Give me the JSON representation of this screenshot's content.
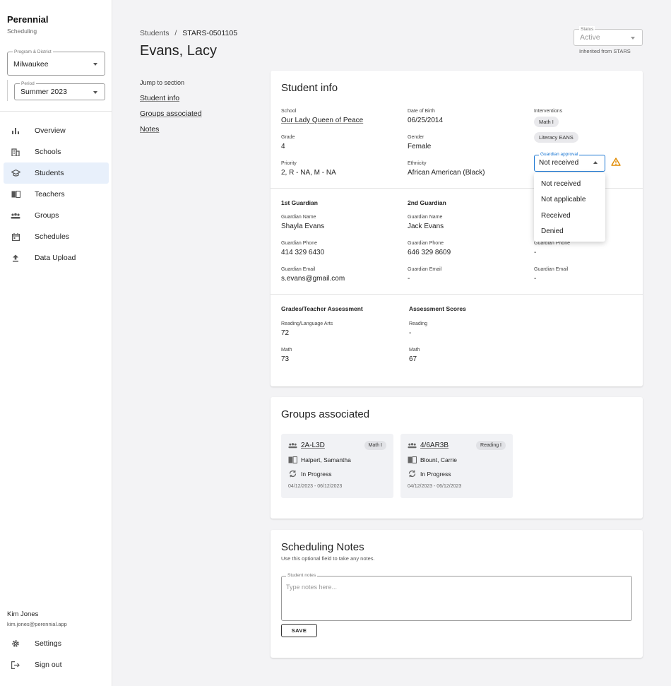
{
  "brand": {
    "title": "Perennial",
    "subtitle": "Scheduling"
  },
  "program_select": {
    "label": "Program & District",
    "value": "Milwaukee"
  },
  "period_select": {
    "label": "Period",
    "value": "Summer 2023"
  },
  "nav": [
    {
      "label": "Overview",
      "icon": "bar-chart-icon"
    },
    {
      "label": "Schools",
      "icon": "building-icon"
    },
    {
      "label": "Students",
      "icon": "graduation-cap-icon",
      "active": true
    },
    {
      "label": "Teachers",
      "icon": "book-icon"
    },
    {
      "label": "Groups",
      "icon": "people-group-icon"
    },
    {
      "label": "Schedules",
      "icon": "calendar-icon"
    },
    {
      "label": "Data Upload",
      "icon": "upload-icon"
    }
  ],
  "user": {
    "name": "Kim Jones",
    "email": "kim.jones@perennial.app"
  },
  "bottom_nav": {
    "settings": "Settings",
    "signout": "Sign out"
  },
  "breadcrumb": {
    "root": "Students",
    "sep": "/",
    "current": "STARS-0501105"
  },
  "page_title": "Evans, Lacy",
  "status": {
    "label": "Status",
    "value": "Active",
    "note": "Inherited from STARS"
  },
  "jump": {
    "title": "Jump to section",
    "links": [
      "Student info",
      "Groups associated",
      "Notes"
    ]
  },
  "student_info": {
    "title": "Student info",
    "school": {
      "label": "School",
      "value": "Our Lady Queen of Peace"
    },
    "dob": {
      "label": "Date of Birth",
      "value": "06/25/2014"
    },
    "interventions": {
      "label": "Interventions",
      "chips": [
        "Math I",
        "Literacy EANS"
      ]
    },
    "grade": {
      "label": "Grade",
      "value": "4"
    },
    "gender": {
      "label": "Gender",
      "value": "Female"
    },
    "priority": {
      "label": "Priority",
      "value": "2, R - NA, M - NA"
    },
    "ethnicity": {
      "label": "Ethnicity",
      "value": "African American (Black)"
    },
    "guardian_approval": {
      "label": "Guardian approval",
      "value": "Not received",
      "options": [
        "Not received",
        "Not applicable",
        "Received",
        "Denied"
      ]
    },
    "guardian1": {
      "heading": "1st Guardian",
      "name_label": "Guardian Name",
      "name": "Shayla Evans",
      "phone_label": "Guardian Phone",
      "phone": "414 329 6430",
      "email_label": "Guardian Email",
      "email": "s.evans@gmail.com"
    },
    "guardian2": {
      "heading": "2nd Guardian",
      "name_label": "Guardian Name",
      "name": "Jack Evans",
      "phone_label": "Guardian Phone",
      "phone": "646 329 8609",
      "email_label": "Guardian Email",
      "email": "-"
    },
    "guardian3": {
      "phone_label": "Guardian Phone",
      "phone": "-",
      "email_label": "Guardian Email",
      "email": "-"
    },
    "grades": {
      "heading": "Grades/Teacher Assessment",
      "reading_label": "Reading/Language Arts",
      "reading": "72",
      "math_label": "Math",
      "math": "73"
    },
    "scores": {
      "heading": "Assessment Scores",
      "reading_label": "Reading",
      "reading": "-",
      "math_label": "Math",
      "math": "67"
    }
  },
  "groups": {
    "title": "Groups associated",
    "items": [
      {
        "id": "2A-L3D",
        "tag": "Math I",
        "teacher": "Halpert, Samantha",
        "status": "In Progress",
        "dates": "04/12/2023 - 06/12/2023"
      },
      {
        "id": "4/6AR3B",
        "tag": "Reading I",
        "teacher": "Blount, Carrie",
        "status": "In Progress",
        "dates": "04/12/2023 - 06/12/2023"
      }
    ]
  },
  "notes": {
    "title": "Scheduling Notes",
    "subtitle": "Use this optional field to take any notes.",
    "field_label": "Student notes",
    "placeholder": "Type notes here...",
    "save": "SAVE"
  },
  "colors": {
    "accent": "#1976d2",
    "warning": "#e08a00",
    "active_nav": "#e8f0fb"
  }
}
